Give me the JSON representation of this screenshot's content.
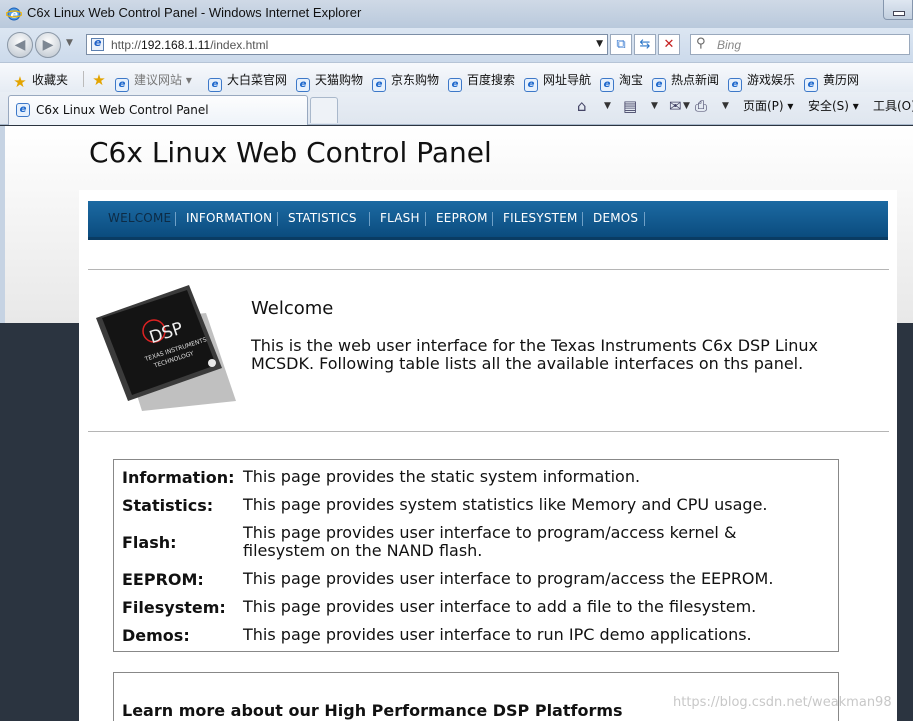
{
  "window": {
    "title": "C6x Linux Web Control Panel - Windows Internet Explorer"
  },
  "address_bar": {
    "url_prefix": "http://",
    "url_host": "192.168.1.11",
    "url_path": "/index.html",
    "search_placeholder": "Bing"
  },
  "favorites_bar": {
    "favorites_label": "收藏夹",
    "items": [
      "建议网站",
      "大白菜官网",
      "天猫购物",
      "京东购物",
      "百度搜索",
      "网址导航",
      "淘宝",
      "热点新闻",
      "游戏娱乐",
      "黄历网"
    ]
  },
  "tabs": [
    {
      "label": "C6x Linux Web Control Panel"
    }
  ],
  "command_bar": {
    "page_label": "页面(P)",
    "safety_label": "安全(S)",
    "tools_label": "工具(O)"
  },
  "page": {
    "heading": "C6x Linux Web Control Panel",
    "menu": [
      "WELCOME",
      "INFORMATION",
      "STATISTICS",
      "FLASH",
      "EEPROM",
      "FILESYSTEM",
      "DEMOS"
    ],
    "active_menu": "WELCOME",
    "chip_text_1": "DSP",
    "chip_text_2": "TEXAS INSTRUMENTS",
    "chip_text_3": "TECHNOLOGY",
    "welcome_title": "Welcome",
    "intro": "This is the web user interface for the Texas Instruments C6x DSP Linux MCSDK. Following table lists all the available interfaces on ths panel.",
    "rows": [
      {
        "key": "Information:",
        "value": "This page provides the static system information."
      },
      {
        "key": "Statistics:",
        "value": "This page provides system statistics like Memory and CPU usage."
      },
      {
        "key": "Flash:",
        "value": "This page provides user interface to program/access kernel & filesystem on the NAND flash."
      },
      {
        "key": "EEPROM:",
        "value": "This page provides user interface to program/access the EEPROM."
      },
      {
        "key": "Filesystem:",
        "value": "This page provides user interface to add a file to the filesystem."
      },
      {
        "key": "Demos:",
        "value": "This page provides user interface to run IPC demo applications."
      }
    ],
    "learn_more": "Learn more about our High Performance DSP Platforms"
  },
  "watermark": "https://blog.csdn.net/weakman98"
}
